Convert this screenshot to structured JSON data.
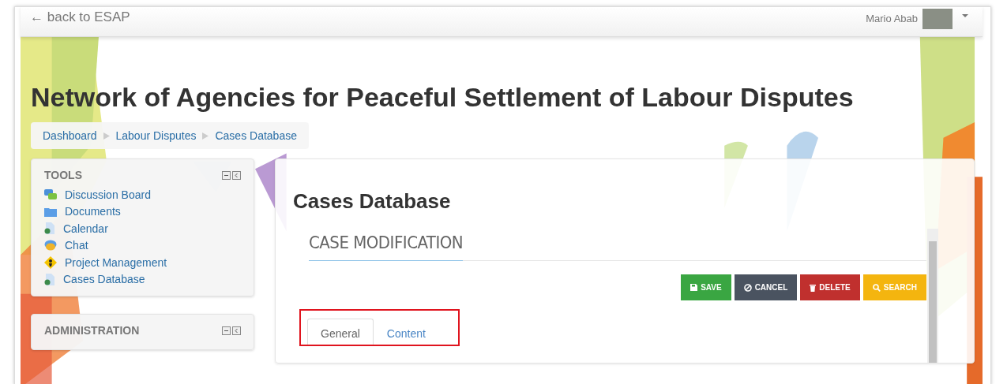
{
  "navbar": {
    "back_link": "← back to ESAP",
    "user_name": "Mario Abab"
  },
  "page_title": "Network of Agencies for Peaceful Settlement of Labour Disputes",
  "breadcrumb": [
    {
      "label": "Dashboard"
    },
    {
      "label": "Labour Disputes"
    },
    {
      "label": "Cases Database"
    }
  ],
  "blocks": [
    {
      "title": "TOOLS",
      "items": [
        {
          "label": "Discussion Board",
          "kind": "forum"
        },
        {
          "label": "Documents",
          "kind": "folder"
        },
        {
          "label": "Calendar",
          "kind": "page"
        },
        {
          "label": "Chat",
          "kind": "chat"
        },
        {
          "label": "Project Management",
          "kind": "project"
        },
        {
          "label": "Cases Database",
          "kind": "page"
        }
      ]
    },
    {
      "title": "ADMINISTRATION"
    }
  ],
  "main": {
    "heading": "Cases Database",
    "section_title": "CASE MODIFICATION",
    "buttons": [
      {
        "label": "SAVE",
        "kind": "save"
      },
      {
        "label": "CANCEL",
        "kind": "cancel"
      },
      {
        "label": "DELETE",
        "kind": "delete"
      },
      {
        "label": "SEARCH",
        "kind": "search"
      }
    ],
    "tabs": [
      {
        "label": "General",
        "selected": true
      },
      {
        "label": "Content",
        "selected": false
      }
    ]
  }
}
